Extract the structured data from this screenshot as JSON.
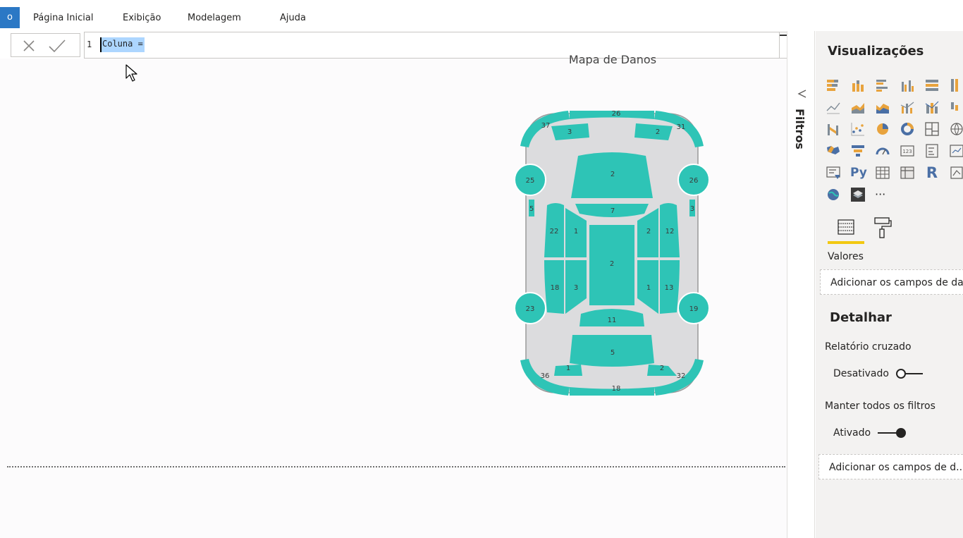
{
  "menu": {
    "file_label": "o",
    "items": [
      "Página Inicial",
      "Exibição",
      "Modelagem",
      "Ajuda"
    ]
  },
  "formula_bar": {
    "line_number": "1",
    "text": "Coluna ="
  },
  "canvas": {
    "visual_title": "Mapa de Danos",
    "car_map": {
      "accent_color": "#2ec4b6",
      "body_color": "#dcdcde",
      "regions": {
        "roof_front": "26",
        "front_left_corner": "37",
        "front_left_light": "3",
        "front_right_light": "2",
        "front_right_corner": "31",
        "hood": "2",
        "front_left_wheel": "25",
        "front_right_wheel": "26",
        "left_mirror": "5",
        "right_mirror": "3",
        "windshield": "7",
        "front_left_door": "22",
        "front_left_window": "1",
        "front_right_window": "2",
        "front_right_door": "12",
        "roof": "2",
        "rear_left_door": "18",
        "rear_left_window": "3",
        "rear_right_window": "1",
        "rear_right_door": "13",
        "rear_left_wheel": "23",
        "rear_right_wheel": "19",
        "rear_window": "11",
        "trunk": "5",
        "rear_left_light": "1",
        "rear_right_light": "2",
        "rear_left_corner": "36",
        "rear_right_corner": "32",
        "rear_bumper": "18"
      }
    }
  },
  "filters_pane": {
    "label": "Filtros"
  },
  "visualizations_pane": {
    "title": "Visualizações",
    "gallery_icons": [
      "stacked-bar-chart-icon",
      "stacked-column-chart-icon",
      "clustered-bar-chart-icon",
      "clustered-column-chart-icon",
      "100-stacked-bar-chart-icon",
      "100-stacked-column-chart-icon",
      "line-chart-icon",
      "area-chart-icon",
      "stacked-area-chart-icon",
      "line-and-column-chart-icon",
      "line-and-stacked-column-chart-icon",
      "waterfall-chart-icon",
      "ribbon-chart-icon",
      "scatter-chart-icon",
      "pie-chart-icon",
      "donut-chart-icon",
      "treemap-icon",
      "map-icon",
      "filled-map-icon",
      "funnel-icon",
      "gauge-icon",
      "card-icon",
      "multi-row-card-icon",
      "kpi-icon",
      "slicer-icon",
      "python-visual-icon",
      "table-icon",
      "matrix-icon",
      "r-visual-icon",
      "arcgis-icon",
      "globe-icon",
      "custom-visual-icon",
      "more-visuals-icon"
    ],
    "python_label": "Py",
    "r_label": "R",
    "more_label": "···",
    "values_label": "Valores",
    "values_drop_placeholder": "Adicionar os campos de da",
    "drill_title": "Detalhar",
    "cross_report_label": "Relatório cruzado",
    "cross_report_state": "Desativado",
    "keep_filters_label": "Manter todos os filtros",
    "keep_filters_state": "Ativado",
    "drill_drop_placeholder": "Adicionar os campos de d..."
  }
}
